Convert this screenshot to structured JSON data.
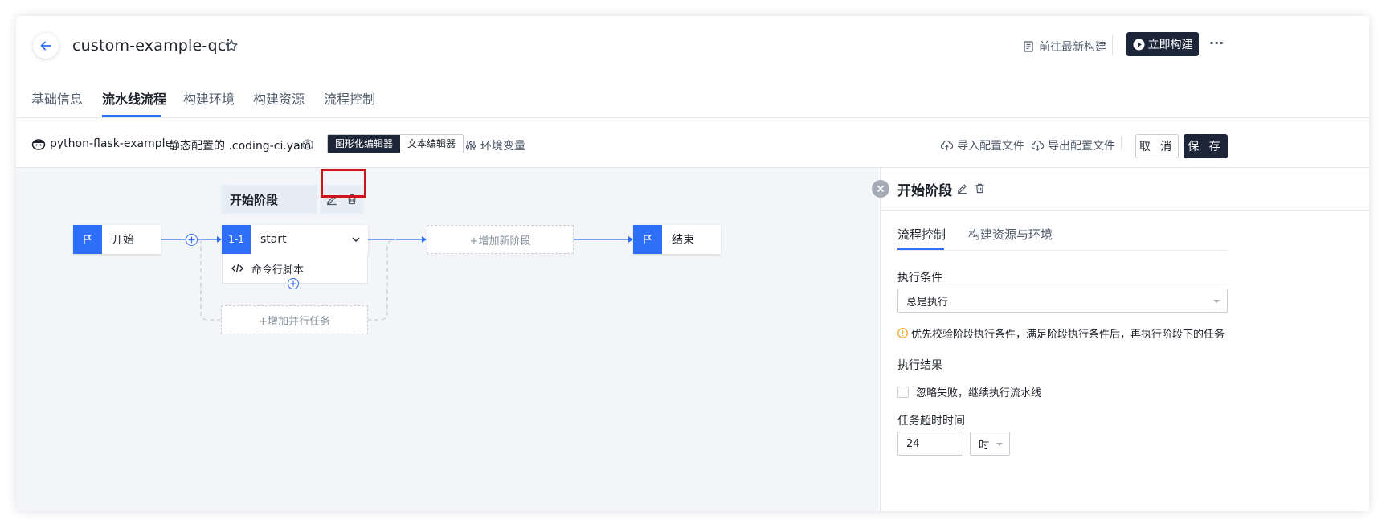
{
  "header": {
    "title": "custom-example-qci",
    "latest_build_label": "前往最新构建",
    "build_now_label": "立即构建",
    "more_label": "···"
  },
  "tabs": [
    {
      "label": "基础信息"
    },
    {
      "label": "流水线流程"
    },
    {
      "label": "构建环境"
    },
    {
      "label": "构建资源"
    },
    {
      "label": "流程控制"
    }
  ],
  "toolbar": {
    "repo": "python-flask-example",
    "config_prefix": "静态配置的 .coding-ci.yaml",
    "graph_editor": "图形化编辑器",
    "text_editor": "文本编辑器",
    "env_vars": "环境变量",
    "import_config": "导入配置文件",
    "export_config": "导出配置文件",
    "cancel": "取 消",
    "save": "保 存"
  },
  "canvas": {
    "stage_name": "开始阶段",
    "start_node": "开始",
    "end_node": "结束",
    "job_index": "1-1",
    "job_name": "start",
    "step_name": "命令行脚本",
    "add_stage": "+增加新阶段",
    "add_parallel": "+增加并行任务"
  },
  "panel": {
    "stage_title": "开始阶段",
    "tab_flow": "流程控制",
    "tab_resource": "构建资源与环境",
    "exec_condition_label": "执行条件",
    "exec_condition_value": "总是执行",
    "hint": "优先校验阶段执行条件，满足阶段执行条件后，再执行阶段下的任务",
    "exec_result_label": "执行结果",
    "ignore_fail_label": "忽略失败，继续执行流水线",
    "ignore_fail_checked": false,
    "timeout_label": "任务超时时间",
    "timeout_value": "24",
    "timeout_unit": "时"
  },
  "colors": {
    "accent": "#2f6ef6",
    "primary_dark": "#1d2539",
    "highlight": "#d0131b",
    "warning": "#f5a623"
  }
}
